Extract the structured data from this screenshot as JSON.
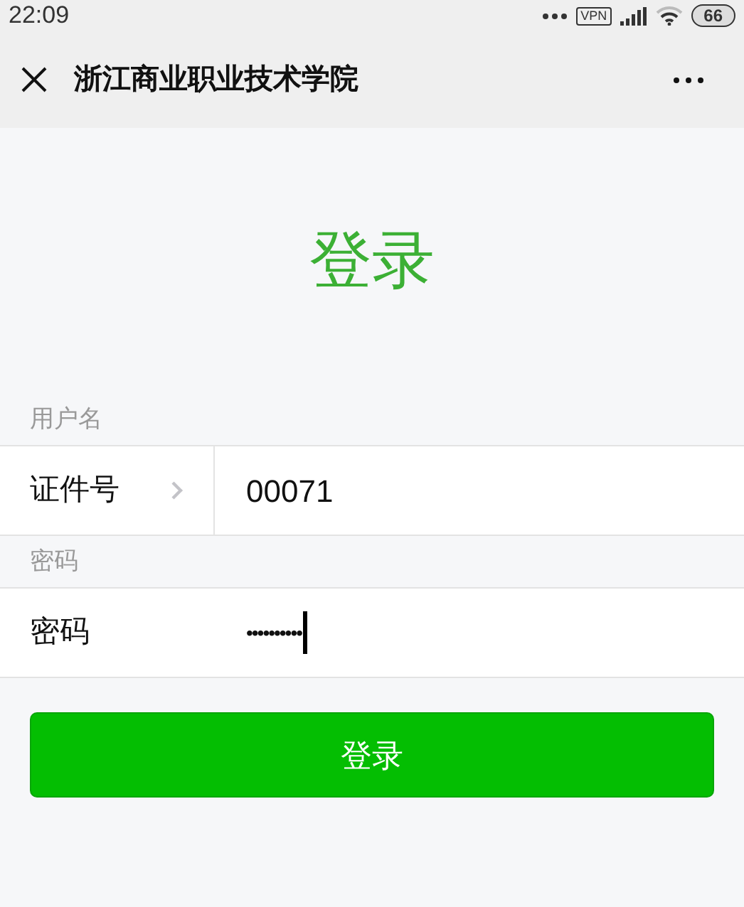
{
  "status_bar": {
    "time": "22:09",
    "vpn": "VPN",
    "battery": "66"
  },
  "nav_bar": {
    "title": "浙江商业职业技术学院"
  },
  "heading": "登录",
  "sections": [
    {
      "label": "用户名",
      "kind": "select",
      "field_label": "证件号",
      "value": "00071"
    },
    {
      "label": "密码",
      "kind": "password",
      "field_label": "密码",
      "value": "••••••••••"
    }
  ],
  "submit_button": "登录"
}
